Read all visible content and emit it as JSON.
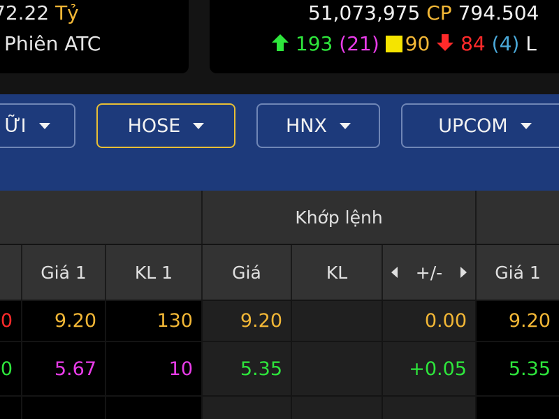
{
  "top_left": {
    "value": "72.22",
    "unit": "Tỷ",
    "session": "Phiên ATC"
  },
  "top_right": {
    "volume": "51,073,975",
    "cp_label": "CP",
    "value": "794.504",
    "up_count": "193",
    "ceiling_count": "(21)",
    "unchanged_count": "90",
    "down_count": "84",
    "floor_count": "(4)",
    "trailing": "L"
  },
  "exchanges": {
    "first_label": "ỮI",
    "hose_label": "HOSE",
    "hnx_label": "HNX",
    "upcom_label": "UPCOM"
  },
  "table": {
    "group_header": "Khớp lệnh",
    "columns": [
      "Giá 1",
      "KL 1",
      "Giá",
      "KL",
      "+/-",
      "Giá 1"
    ],
    "rows": [
      {
        "left": "0",
        "gia1": "9.20",
        "kl1": "130",
        "gia": "9.20",
        "kl": "",
        "change": "0.00",
        "gia1b": "9.20",
        "colors": [
          "#ff2a2a",
          "#f2b736",
          "#f2b736",
          "#f2b736",
          "#f2b736",
          "#f2b736",
          "#f2b736"
        ]
      },
      {
        "left": "0",
        "gia1": "5.67",
        "kl1": "10",
        "gia": "5.35",
        "kl": "",
        "change": "+0.05",
        "gia1b": "5.35",
        "colors": [
          "#2ee63c",
          "#e83ce8",
          "#e83ce8",
          "#2ee63c",
          "#2ee63c",
          "#2ee63c",
          "#2ee63c"
        ]
      }
    ]
  },
  "icons": {
    "up": "arrow-up-icon",
    "down": "arrow-down-icon",
    "square": "square-icon"
  }
}
